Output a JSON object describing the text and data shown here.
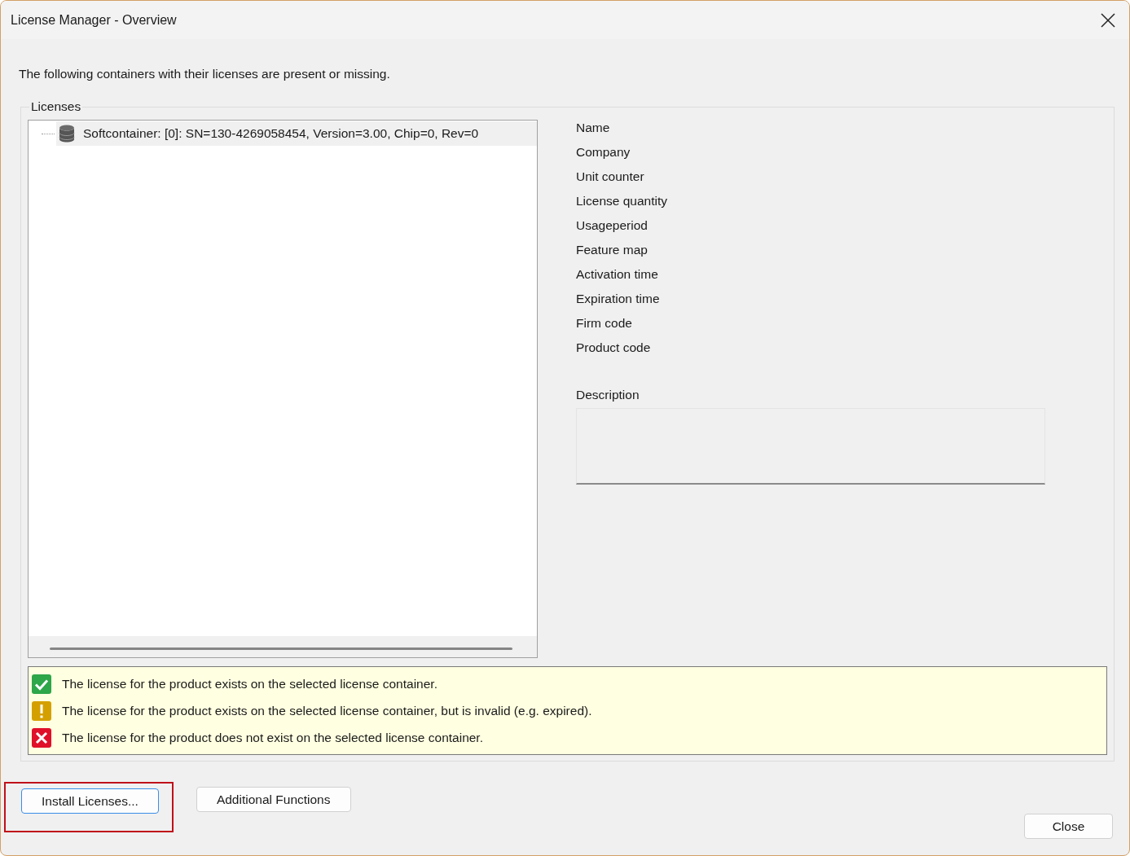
{
  "window": {
    "title": "License Manager - Overview"
  },
  "intro": "The following containers with their licenses are present or missing.",
  "licenses_group": {
    "label": "Licenses",
    "tree": [
      {
        "label": "Softcontainer: [0]: SN=130-4269058454, Version=3.00, Chip=0, Rev=0",
        "selected": true
      }
    ]
  },
  "details": {
    "fields": [
      "Name",
      "Company",
      "Unit counter",
      "License quantity",
      "Usageperiod",
      "Feature map",
      "Activation time",
      "Expiration time",
      "Firm code",
      "Product code"
    ],
    "description_label": "Description"
  },
  "legend": [
    {
      "kind": "ok",
      "text": "The license for the product exists on the selected license container."
    },
    {
      "kind": "warning",
      "text": "The license for the product exists on the selected license container, but is invalid (e.g. expired)."
    },
    {
      "kind": "error",
      "text": "The license for the product does not exist on the selected license container."
    }
  ],
  "buttons": [
    {
      "label": "Install Licenses...",
      "highlighted": true
    },
    {
      "label": "Additional Functions",
      "highlighted": false
    }
  ],
  "close_button": "Close"
}
